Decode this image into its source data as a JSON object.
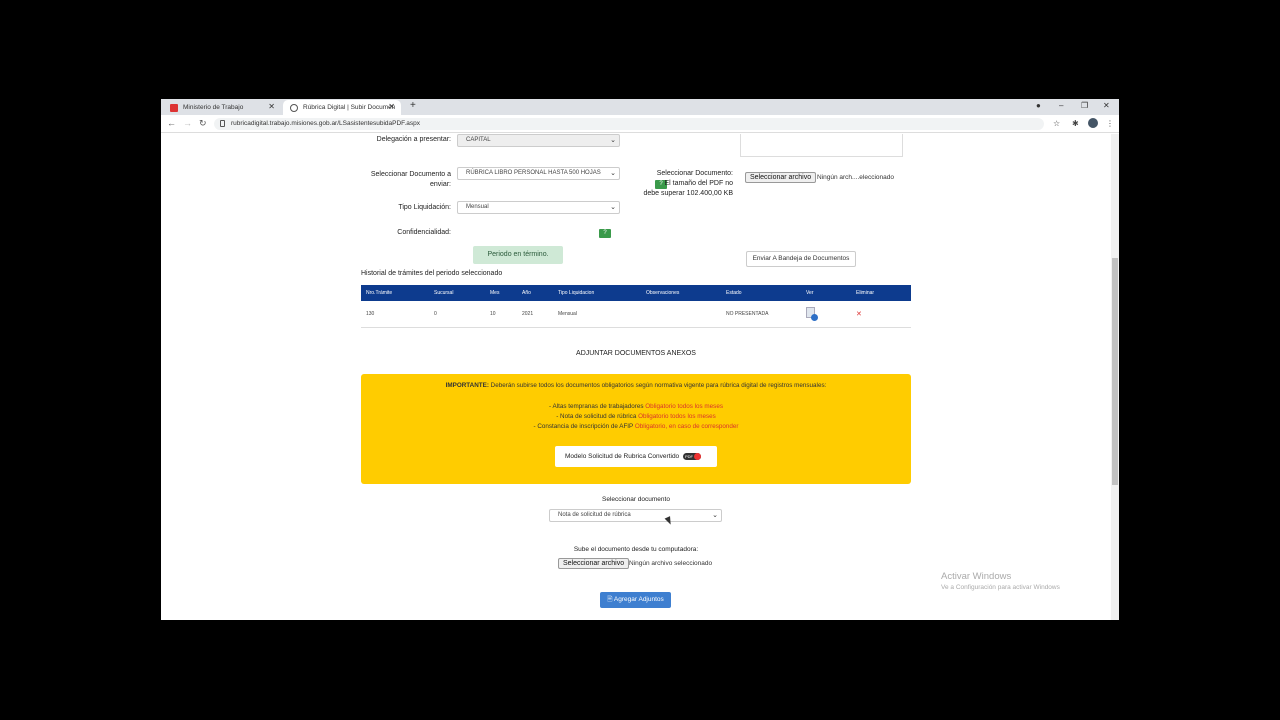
{
  "browser": {
    "tabs": [
      {
        "label": "Ministerio de Trabajo"
      },
      {
        "label": "Rúbrica Digital | Subir Documen"
      }
    ],
    "url": "rubricadigital.trabajo.misiones.gob.ar/LSasistentesubidaPDF.aspx"
  },
  "form": {
    "delegacion_label": "Delegación a presentar:",
    "delegacion_value": "CAPITAL",
    "doc_label": "Seleccionar Documento a enviar:",
    "doc_value": "RÚBRICA LIBRO PERSONAL HASTA 500 HOJAS",
    "tipo_label": "Tipo Liquidación:",
    "tipo_value": "Mensual",
    "conf_label": "Confidencialidad:",
    "help_badge": "?",
    "sel_doc_label": "Seleccionar Documento:",
    "size_note": "El tamaño del PDF no debe superar 102.400,00 KB",
    "file_btn": "Seleccionar archivo",
    "file_status": "Ningún arch....eleccionado",
    "periodo": "Periodo en término.",
    "enviar_btn": "Enviar A Bandeja de Documentos"
  },
  "history": {
    "title": "Historial de trámites del periodo seleccionado",
    "headers": [
      "Nro.Trámite",
      "Sucursal",
      "Mes",
      "Año",
      "Tipo Liquidacion",
      "Observaciones",
      "Estado",
      "Ver",
      "Eliminar"
    ],
    "rows": [
      {
        "tramite": "130",
        "sucursal": "0",
        "mes": "10",
        "anio": "2021",
        "tipo": "Mensual",
        "obs": "",
        "estado": "NO PRESENTADA"
      }
    ]
  },
  "anexos": {
    "title": "ADJUNTAR DOCUMENTOS ANEXOS",
    "important_bold": "IMPORTANTE:",
    "important_text": " Deberán subirse todos los documentos obligatorios según normativa vigente para rúbrica digital de registros mensuales:",
    "items": [
      {
        "text": "- Altas tempranas de trabajadores ",
        "note": "Obligatorio todos los meses"
      },
      {
        "text": "- Nota de solicitud de rúbrica ",
        "note": "Obligatorio todos los meses"
      },
      {
        "text": "- Constancia de inscripción de AFIP ",
        "note": "Obligatorio, en caso de corresponder"
      }
    ],
    "modelo_btn": "Modelo Solicitud de Rubrica Convertido",
    "pdf_badge": "PDF",
    "select_label": "Seleccionar documento",
    "select_value": "Nota de solicitud de rúbrica",
    "upload_label": "Sube el documento desde tu computadora:",
    "file_btn": "Seleccionar archivo",
    "file_status": "Ningún archivo seleccionado",
    "add_btn": "Agregar Adjuntos"
  },
  "watermark": {
    "line1": "Activar Windows",
    "line2": "Ve a Configuración para activar Windows"
  }
}
